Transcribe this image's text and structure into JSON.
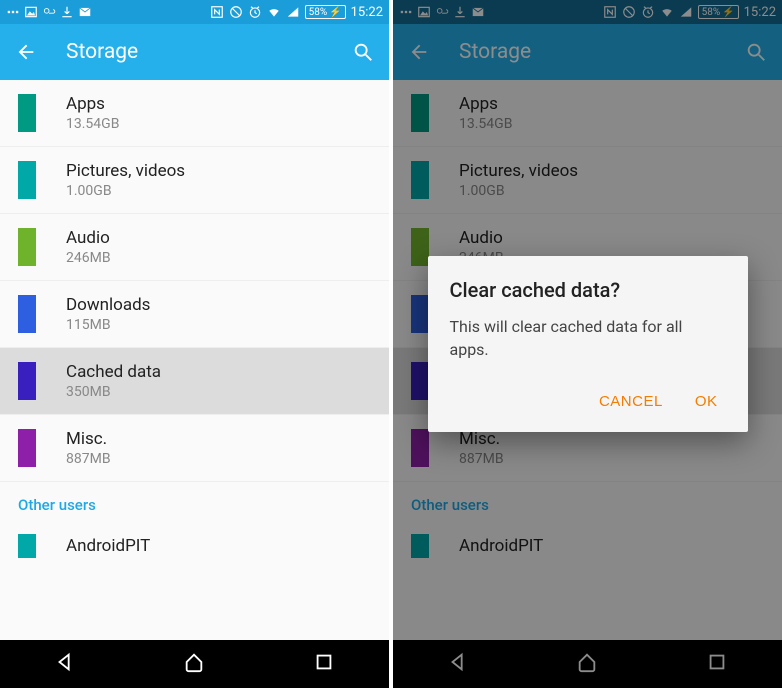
{
  "status": {
    "battery": "58%",
    "time": "15:22"
  },
  "appbar": {
    "title": "Storage"
  },
  "items": [
    {
      "title": "Apps",
      "sub": "13.54GB",
      "color": "#009a82"
    },
    {
      "title": "Pictures, videos",
      "sub": "1.00GB",
      "color": "#00a8a8"
    },
    {
      "title": "Audio",
      "sub": "246MB",
      "color": "#6fb32d"
    },
    {
      "title": "Downloads",
      "sub": "115MB",
      "color": "#2d5fe0"
    },
    {
      "title": "Cached data",
      "sub": "350MB",
      "color": "#3a1fbf"
    },
    {
      "title": "Misc.",
      "sub": "887MB",
      "color": "#8e1fa8"
    }
  ],
  "section_other": "Other users",
  "other_item": {
    "title": "AndroidPIT",
    "color": "#00a8a8"
  },
  "dialog": {
    "title": "Clear cached data?",
    "message": "This will clear cached data for all apps.",
    "cancel": "CANCEL",
    "ok": "OK"
  }
}
